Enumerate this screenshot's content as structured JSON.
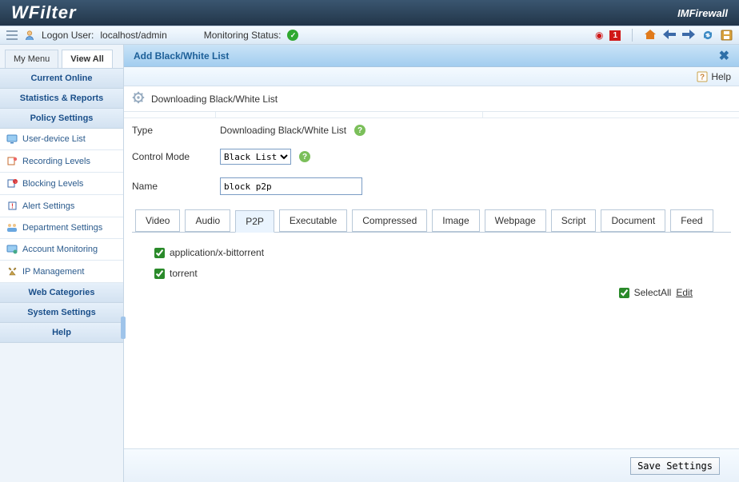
{
  "top": {
    "logo": "WFilter",
    "brand": "IMFirewall"
  },
  "status": {
    "logon_label": "Logon User:",
    "logon_value": "localhost/admin",
    "monitoring_label": "Monitoring Status:",
    "alert_count": "1"
  },
  "sidebar": {
    "tabs": {
      "my": "My Menu",
      "all": "View All"
    },
    "heads": {
      "current": "Current Online",
      "stats": "Statistics & Reports",
      "policy": "Policy Settings",
      "webcat": "Web Categories",
      "system": "System Settings",
      "help": "Help"
    },
    "items": [
      {
        "label": "User-device List"
      },
      {
        "label": "Recording Levels"
      },
      {
        "label": "Blocking Levels"
      },
      {
        "label": "Alert Settings"
      },
      {
        "label": "Department Settings"
      },
      {
        "label": "Account Monitoring"
      },
      {
        "label": "IP Management"
      }
    ]
  },
  "content": {
    "title": "Add Black/White List",
    "help": "Help",
    "section_title": "Downloading Black/White List",
    "type_label": "Type",
    "type_value": "Downloading Black/White List",
    "mode_label": "Control Mode",
    "mode_value": "Black List",
    "name_label": "Name",
    "name_value": "block p2p",
    "tabs": [
      "Video",
      "Audio",
      "P2P",
      "Executable",
      "Compressed",
      "Image",
      "Webpage",
      "Script",
      "Document",
      "Feed"
    ],
    "active_tab": "P2P",
    "checks": [
      {
        "label": "application/x-bittorrent",
        "checked": true
      },
      {
        "label": "torrent",
        "checked": true
      }
    ],
    "selectall_label": "SelectAll",
    "selectall_checked": true,
    "edit_label": "Edit",
    "save_label": "Save Settings"
  }
}
